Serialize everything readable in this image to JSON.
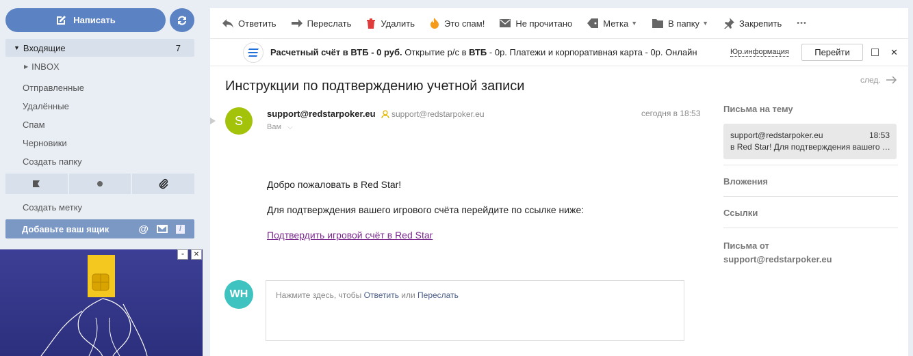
{
  "sidebar": {
    "compose_label": "Написать",
    "folders": [
      {
        "label": "Входящие",
        "count": "7"
      },
      {
        "label": "INBOX"
      },
      {
        "label": "Отправленные"
      },
      {
        "label": "Удалённые"
      },
      {
        "label": "Спам"
      },
      {
        "label": "Черновики"
      },
      {
        "label": "Создать папку"
      }
    ],
    "create_label": "Создать метку",
    "add_mailbox": "Добавьте ваш ящик"
  },
  "toolbar": {
    "reply": "Ответить",
    "forward": "Переслать",
    "delete": "Удалить",
    "spam": "Это спам!",
    "unread": "Не прочитано",
    "label": "Метка",
    "move": "В папку",
    "pin": "Закрепить",
    "more": "•••"
  },
  "ad": {
    "title_bold": "Расчетный счёт в ВТБ - 0 руб.",
    "text_pre": " Открытие р/с в ",
    "text_bold2": "ВТБ",
    "text_post": " - 0р. Платежи и корпоративная карта - 0р. Онлайн",
    "info": "Юр.информация",
    "go": "Перейти",
    "close": "✕"
  },
  "message": {
    "subject": "Инструкции по подтверждению учетной записи",
    "next": "след.",
    "avatar_letter": "S",
    "sender_name": "support@redstarpoker.eu",
    "sender_address": "support@redstarpoker.eu",
    "recipient": "Вам",
    "time": "сегодня в 18:53",
    "greeting": "Добро пожаловать в Red Star!",
    "instruction": "Для подтверждения вашего игрового счёта перейдите по ссылке ниже:",
    "link": "Подтвердить игровой счёт в Red Star"
  },
  "reply": {
    "avatar": "WH",
    "prefix": "Нажмите здесь, чтобы ",
    "reply_link": "Ответить",
    "or": " или ",
    "forward_link": "Переслать"
  },
  "right": {
    "thread_title": "Письма на тему",
    "thread_from": "support@redstarpoker.eu",
    "thread_time": "18:53",
    "thread_snippet": "в Red Star! Для подтверждения вашего игрового счёта",
    "attachments": "Вложения",
    "links": "Ссылки",
    "from_title_1": "Письма от",
    "from_title_2": "support@redstarpoker.eu"
  },
  "colors": {
    "accent": "#5b82c2",
    "avatar_sender": "#a3c20a",
    "avatar_me": "#3ec3c0",
    "link_visited": "#7b2a8e"
  }
}
